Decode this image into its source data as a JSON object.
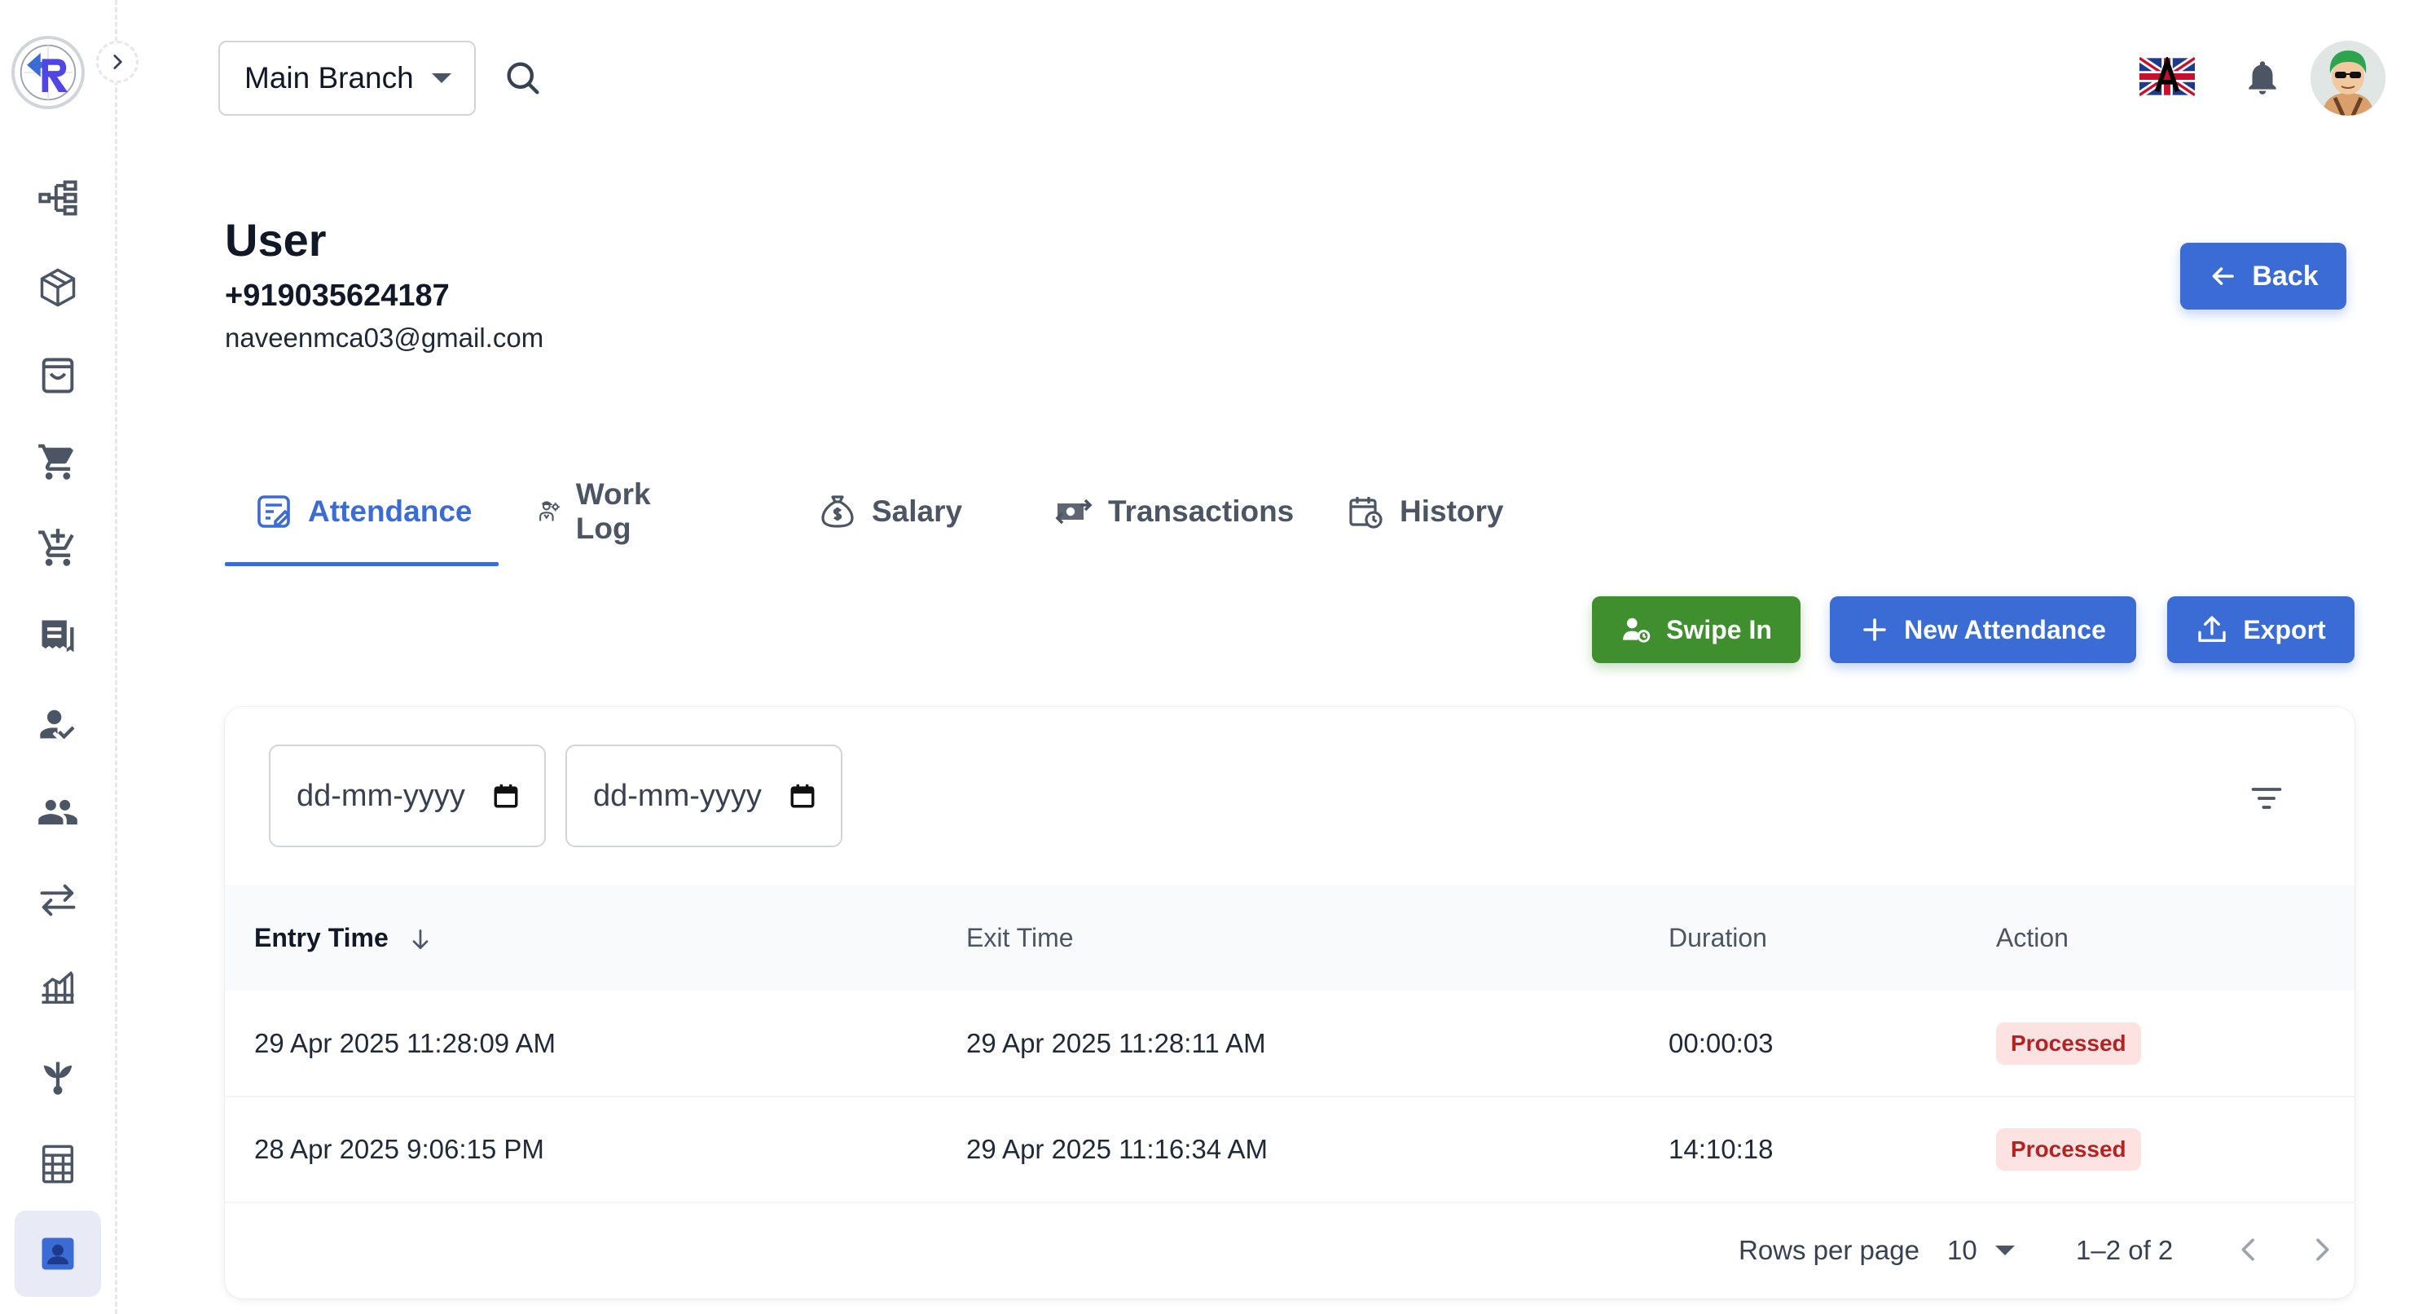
{
  "top_bar": {
    "branch": "Main Branch"
  },
  "user": {
    "title": "User",
    "phone": "+919035624187",
    "email": "naveenmca03@gmail.com"
  },
  "header": {
    "back_label": "Back"
  },
  "tabs": [
    {
      "label": "Attendance",
      "icon": "attendance-icon",
      "active": true
    },
    {
      "label": "Work Log",
      "icon": "work-log-icon",
      "active": false
    },
    {
      "label": "Salary",
      "icon": "money-bag-icon",
      "active": false
    },
    {
      "label": "Transactions",
      "icon": "transactions-icon",
      "active": false
    },
    {
      "label": "History",
      "icon": "history-icon",
      "active": false
    }
  ],
  "actions": {
    "swipe_in": "Swipe In",
    "new_attendance": "New Attendance",
    "export": "Export"
  },
  "filters": {
    "from_date_placeholder": "dd-mm-yyyy",
    "to_date_placeholder": "dd-mm-yyyy"
  },
  "table": {
    "columns": [
      "Entry Time",
      "Exit Time",
      "Duration",
      "Action"
    ],
    "rows": [
      {
        "entry": "29 Apr 2025 11:28:09 AM",
        "exit": "29 Apr 2025 11:28:11 AM",
        "duration": "00:00:03",
        "status": "Processed"
      },
      {
        "entry": "28 Apr 2025 9:06:15 PM",
        "exit": "29 Apr 2025 11:16:34 AM",
        "duration": "14:10:18",
        "status": "Processed"
      }
    ]
  },
  "pagination": {
    "rows_per_page_label": "Rows per page",
    "rows_per_page": "10",
    "range": "1–2 of 2"
  },
  "sidebar": {
    "items": [
      "hierarchy-icon",
      "package-icon",
      "shopping-bag-icon",
      "cart-icon",
      "cart-add-icon",
      "receipt-icon",
      "user-check-icon",
      "group-icon",
      "swap-icon",
      "chart-icon",
      "plant-icon",
      "calculator-icon",
      "user-card-icon"
    ]
  },
  "colors": {
    "primary": "#3b6cd6",
    "success": "#3f8f2e",
    "badge_bg": "#fde2e2",
    "badge_text": "#b42323"
  }
}
